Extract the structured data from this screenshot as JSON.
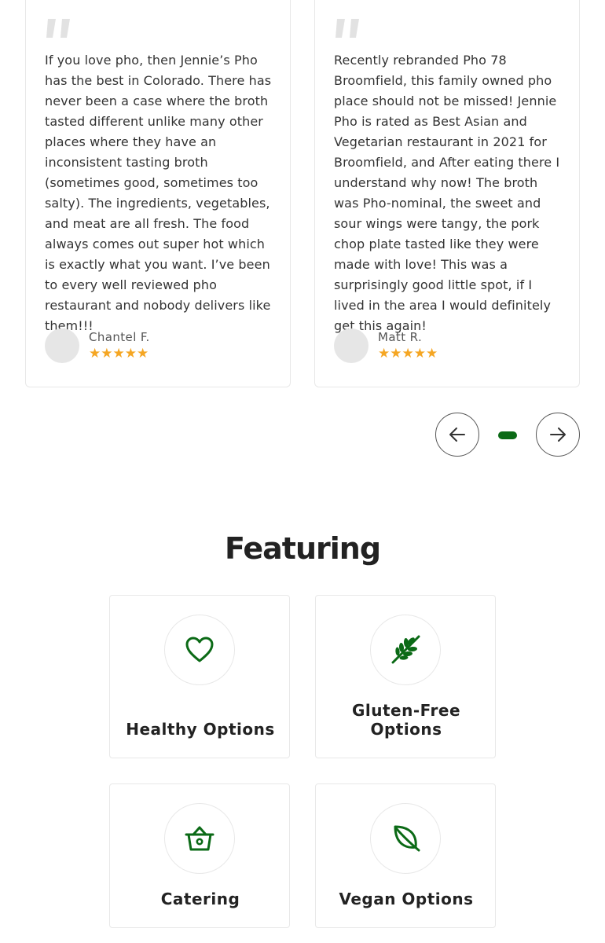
{
  "reviews": [
    {
      "text": "If you love pho, then Jennie’s Pho has the best in Colorado. There has never been a case where the broth tasted different unlike many other places where they have an inconsistent tasting broth (sometimes good, sometimes too salty). The ingredients, vegetables, and meat are all fresh. The food always comes out super hot which is exactly what you want. I’ve been to every well reviewed pho restaurant and nobody delivers like them!!!",
      "name": "Chantel F.",
      "stars": "★★★★★"
    },
    {
      "text": "Recently rebranded Pho 78 Broomfield, this family owned pho place should not be missed! Jennie Pho is rated as Best Asian and Vegetarian restaurant in 2021 for Broomfield, and After eating there I understand why now! The broth was Pho-nominal, the sweet and sour wings were tangy, the pork chop plate tasted like they were made with love! This was a surprisingly good little spot, if I lived in the area I would definitely get this again!",
      "name": "Matt R.",
      "stars": "★★★★★"
    }
  ],
  "carousel": {
    "prev_icon": "arrow-left-icon",
    "next_icon": "arrow-right-icon",
    "active_dot": 1,
    "dot_count": 1
  },
  "featuring": {
    "title": "Featuring",
    "items": [
      {
        "label": "Healthy Options",
        "icon": "heart-icon"
      },
      {
        "label": "Gluten-Free Options",
        "icon": "wheat-icon"
      },
      {
        "label": "Catering",
        "icon": "basket-icon"
      },
      {
        "label": "Vegan Options",
        "icon": "leaf-icon"
      }
    ]
  },
  "colors": {
    "accent": "#0b6a16",
    "star": "#f5a623",
    "quote": "#e0e0e0"
  }
}
